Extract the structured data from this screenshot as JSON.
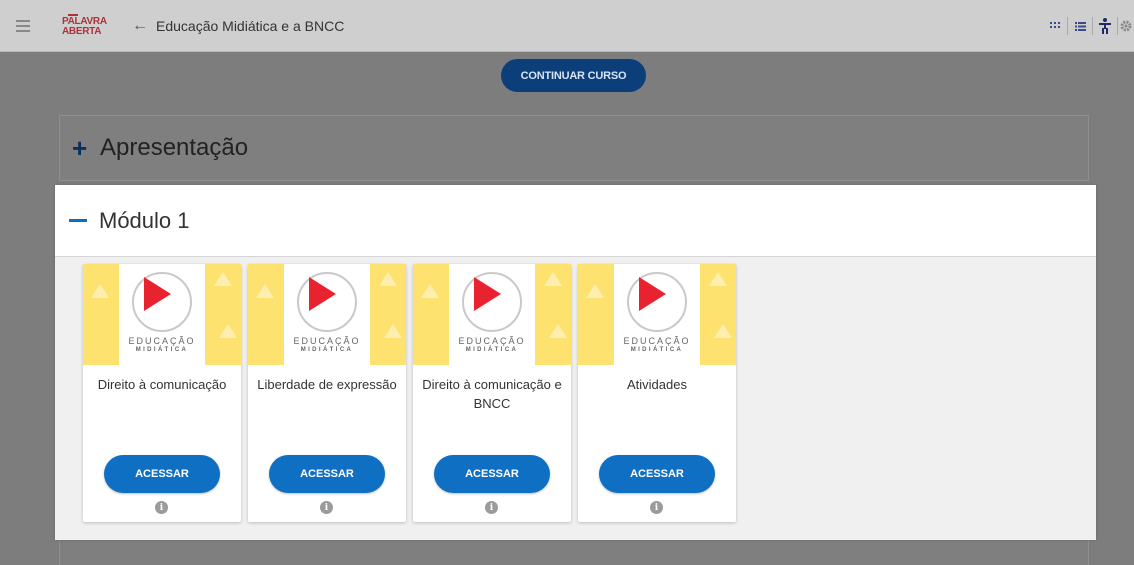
{
  "header": {
    "logo_line1": "PALAVRA",
    "logo_line2": "ABERTA",
    "back_icon": "←",
    "course_title": "Educação Midiática e a BNCC",
    "icons": [
      "grid-view-icon",
      "list-view-icon",
      "accessibility-icon",
      "settings-icon"
    ]
  },
  "continue_button": "CONTINUAR CURSO",
  "sections": {
    "apresentacao": {
      "toggle": "+",
      "title": "Apresentação"
    },
    "modulo1": {
      "title": "Módulo 1"
    }
  },
  "thumb": {
    "edu_line1": "EDUCAÇÃO",
    "edu_line2": "MIDIÁTICA"
  },
  "cards": [
    {
      "name": "Direito à comunicação",
      "button": "ACESSAR",
      "info": "i"
    },
    {
      "name": "Liberdade de expressão",
      "button": "ACESSAR",
      "info": "i"
    },
    {
      "name": "Direito à comunicação e BNCC",
      "button": "ACESSAR",
      "info": "i"
    },
    {
      "name": "Atividades",
      "button": "ACESSAR",
      "info": "i"
    }
  ],
  "colors": {
    "accent": "#0f6fc2",
    "brand": "#b0313a",
    "play": "#e8232f",
    "thumb_yellow": "#fbd957"
  }
}
